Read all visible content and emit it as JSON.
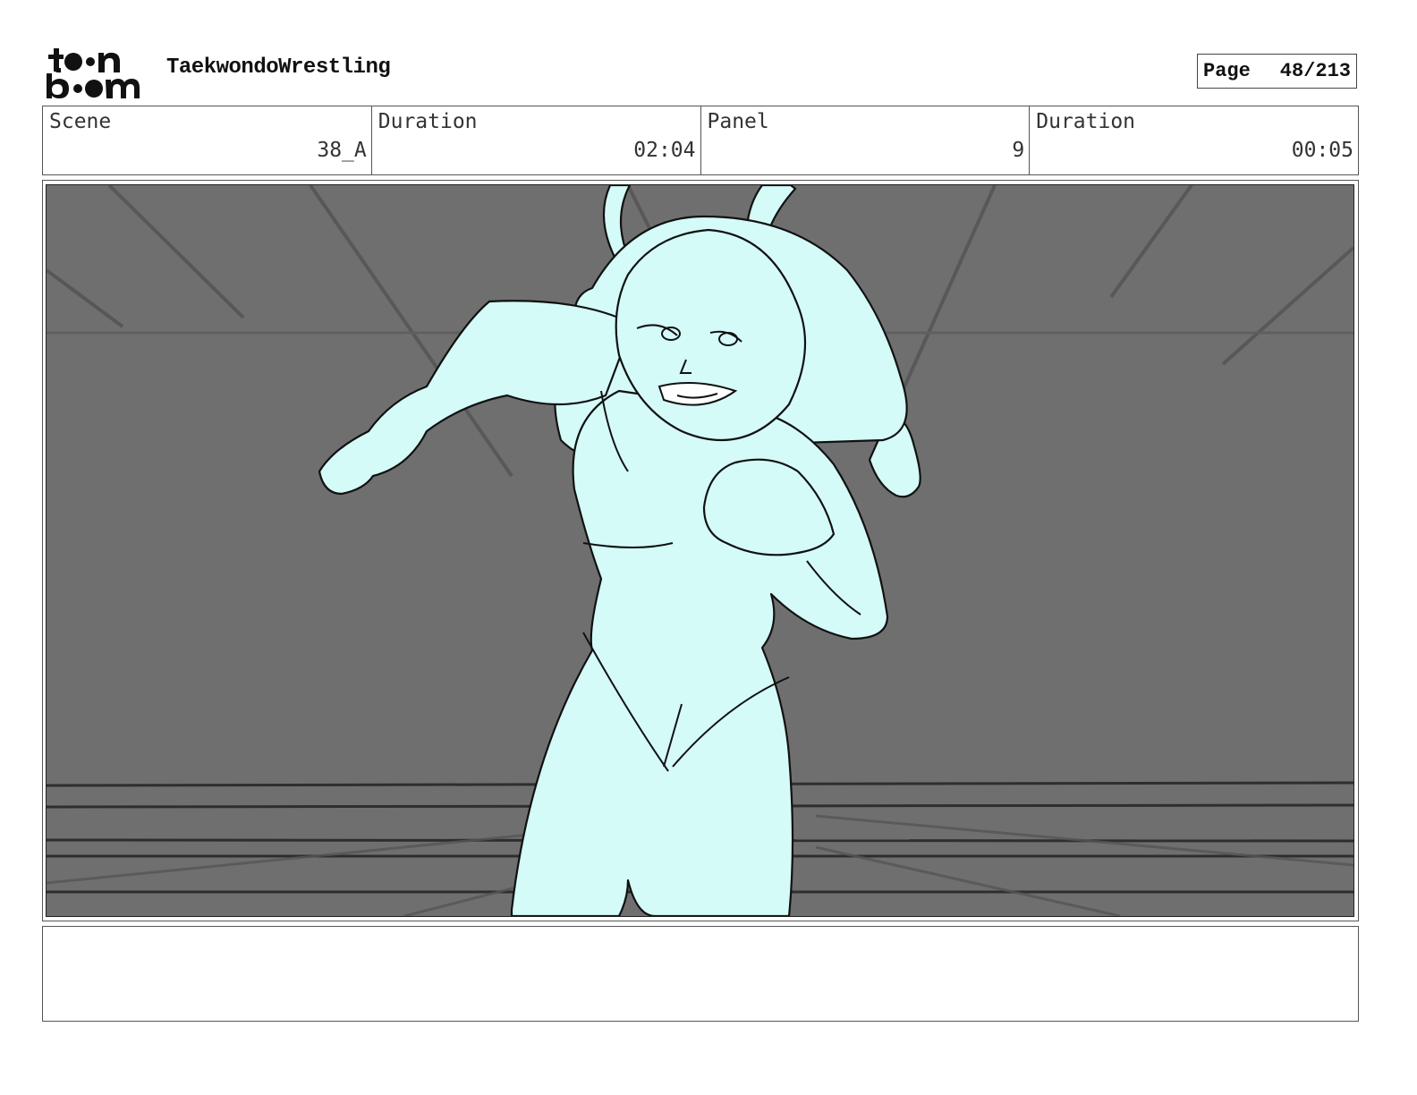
{
  "header": {
    "project_title": "TaekwondoWrestling",
    "page_label": "Page",
    "page_number": "48/213"
  },
  "logo": {
    "icon": "toon-boom-logo",
    "text": "toon boom"
  },
  "info": {
    "scene_label": "Scene",
    "scene_value": "38_A",
    "scene_duration_label": "Duration",
    "scene_duration_value": "02:04",
    "panel_label": "Panel",
    "panel_value": "9",
    "panel_duration_label": "Duration",
    "panel_duration_value": "00:05"
  },
  "panel": {
    "background_color": "#6f6f6f",
    "figure_color": "#d4fbf8"
  },
  "notes": {
    "text": ""
  }
}
